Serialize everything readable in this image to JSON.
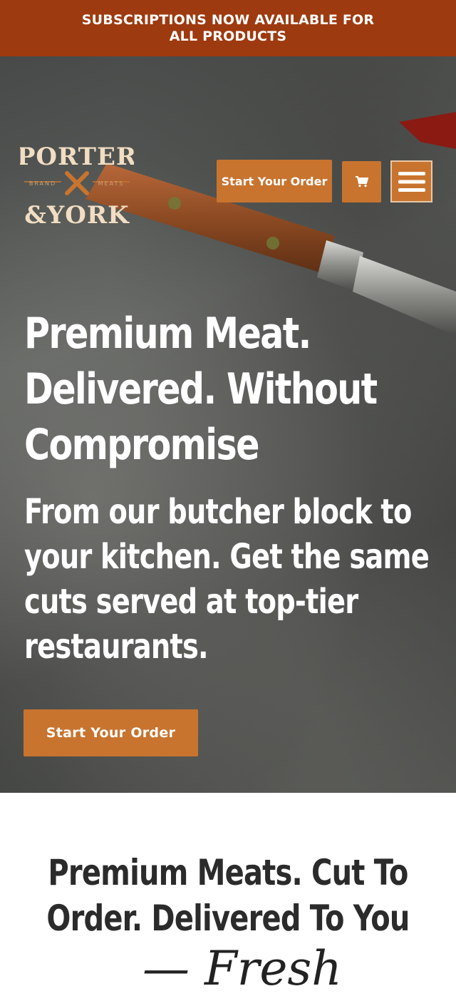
{
  "banner": {
    "text": "SUBSCRIPTIONS NOW AVAILABLE FOR ALL PRODUCTS"
  },
  "header": {
    "logo_top": "PORTER",
    "logo_bottom": "&YORK",
    "logo_left": "BRAND",
    "logo_right": "MEATS",
    "order_button": "Start Your Order",
    "cart_icon": "cart-icon",
    "menu_icon": "hamburger-menu-icon"
  },
  "hero": {
    "title": "Premium Meat. Delivered. Without Compromise",
    "subtitle": "From our butcher block to your kitchen. Get the same cuts served at top-tier restaurants.",
    "cta": "Start Your Order"
  },
  "section": {
    "heading": "Premium Meats. Cut To Order. Delivered To You",
    "script_text": "— Fresh"
  },
  "colors": {
    "banner": "#9e3a0f",
    "accent": "#c8742f",
    "heading": "#2b2b2b"
  }
}
